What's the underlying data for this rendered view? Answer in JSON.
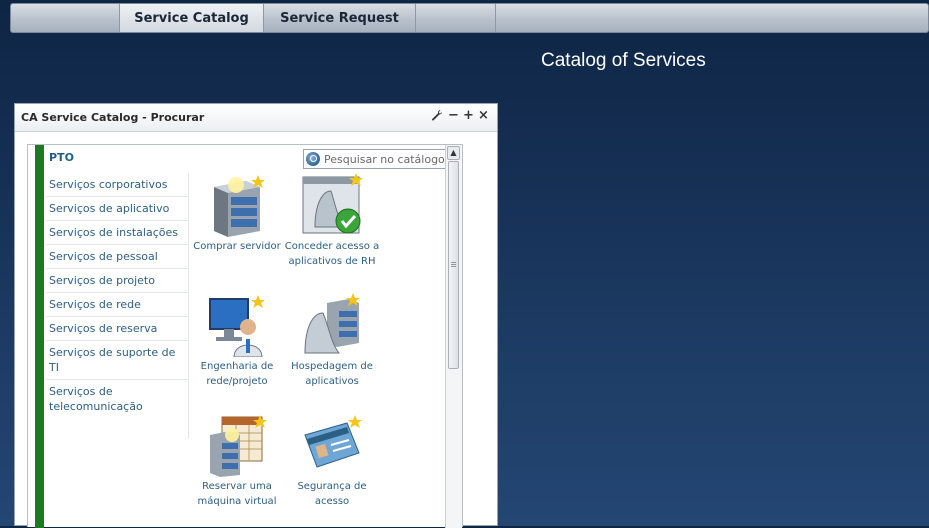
{
  "nav": {
    "tabs": [
      {
        "label": "Service Catalog",
        "active": true
      },
      {
        "label": "Service Request",
        "active": false
      }
    ]
  },
  "page_title": "Catalog of Services",
  "portlet": {
    "title": "CA Service Catalog - Procurar",
    "controls": {
      "settings": "wrench-icon",
      "minimize": "−",
      "maximize": "+",
      "close": "×"
    },
    "section_label": "PTO",
    "search": {
      "placeholder": "Pesquisar no catálogo",
      "value": ""
    },
    "categories": [
      "Serviços corporativos",
      "Serviços de aplicativo",
      "Serviços de instalações",
      "Serviços de pessoal",
      "Serviços de projeto",
      "Serviços de rede",
      "Serviços de reserva",
      "Serviços de suporte de TI",
      "Serviços de telecomunicação"
    ],
    "services": [
      {
        "label": "Comprar servidor",
        "icon": "server-icon"
      },
      {
        "label": "Conceder acesso a aplicativos de RH",
        "icon": "app-access-icon"
      },
      {
        "label": "Engenharia de rede/projeto",
        "icon": "engineer-icon"
      },
      {
        "label": "Hospedagem de aplicativos",
        "icon": "app-hosting-icon"
      },
      {
        "label": "Reservar uma máquina virtual",
        "icon": "virtual-machine-icon"
      },
      {
        "label": "Segurança de acesso",
        "icon": "access-card-icon"
      }
    ]
  },
  "colors": {
    "accent_green": "#1b7a1e",
    "link_blue": "#2c5f86",
    "background_navy": "#163055"
  }
}
